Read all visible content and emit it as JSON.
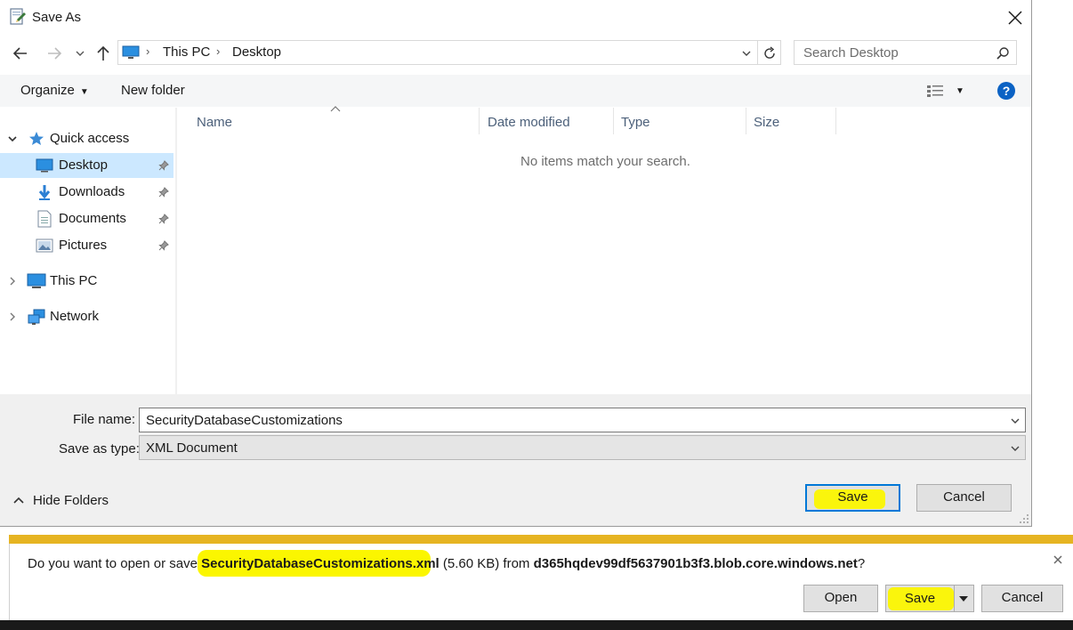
{
  "dialog": {
    "title": "Save As",
    "breadcrumb": [
      "This PC",
      "Desktop"
    ],
    "search_placeholder": "Search Desktop",
    "toolbar": {
      "organize": "Organize",
      "new_folder": "New folder"
    },
    "nav": {
      "quick_access": "Quick access",
      "items": [
        "Desktop",
        "Downloads",
        "Documents",
        "Pictures"
      ],
      "this_pc": "This PC",
      "network": "Network"
    },
    "columns": [
      "Name",
      "Date modified",
      "Type",
      "Size"
    ],
    "empty_message": "No items match your search.",
    "file_name_label": "File name:",
    "file_name_value": "SecurityDatabaseCustomizations",
    "save_type_label": "Save as type:",
    "save_type_value": "XML Document",
    "hide_folders": "Hide Folders",
    "save_label": "Save",
    "cancel_label": "Cancel"
  },
  "download_bar": {
    "prefix": "Do you want to open or save ",
    "filename": "SecurityDatabaseCustomizations.xml",
    "size": " (5.60 KB) from ",
    "host": "d365hqdev99df5637901b3f3.blob.core.windows.net",
    "suffix": "?",
    "open_label": "Open",
    "save_label": "Save",
    "cancel_label": "Cancel"
  },
  "colors": {
    "accent": "#0078d7",
    "highlight": "#fbf600",
    "selection": "#cce8ff",
    "notification_bar": "#e6b422"
  },
  "icons": [
    "save-as-icon",
    "close-icon",
    "back-arrow-icon",
    "forward-arrow-icon",
    "recent-dropdown-icon",
    "up-arrow-icon",
    "computer-icon",
    "refresh-icon",
    "search-icon",
    "view-options-icon",
    "help-icon",
    "star-icon",
    "desktop-icon",
    "download-icon",
    "document-icon",
    "pictures-icon",
    "pin-icon",
    "network-icon",
    "chevron-up-icon",
    "chevron-down-icon",
    "resize-grip-icon"
  ]
}
